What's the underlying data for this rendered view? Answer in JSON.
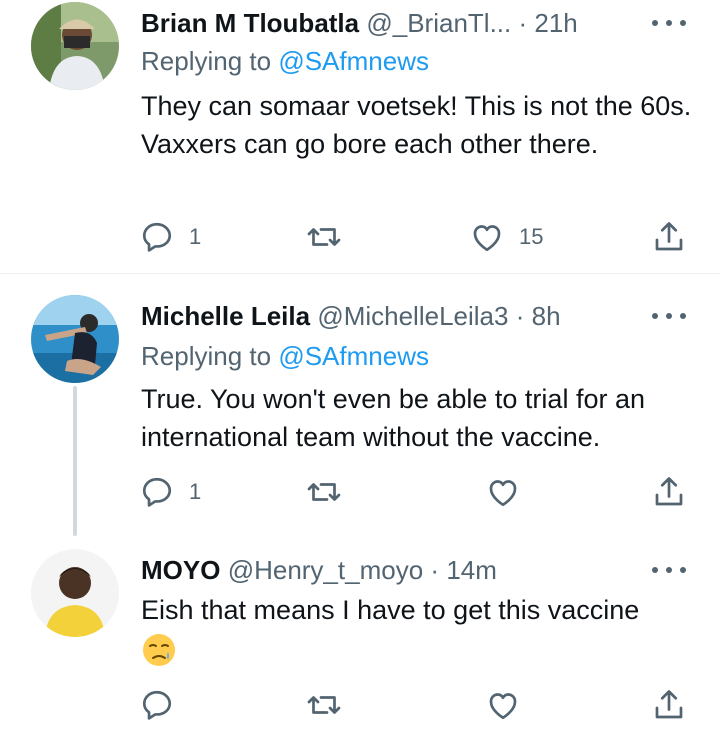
{
  "colors": {
    "text": "#0f1419",
    "secondary": "#536471",
    "link": "#1d9bf0",
    "thread_line": "#cfd9de"
  },
  "icons": {
    "reply": "speech-bubble-icon",
    "retweet": "retweet-arrows-icon",
    "like": "heart-icon",
    "share": "share-upload-icon",
    "more": "three-dots-icon"
  },
  "tweets": [
    {
      "name": "Brian M Tloubatla",
      "handle": "@_BrianTl...",
      "separator": "·",
      "time": "21h",
      "replying_label": "Replying to",
      "replying_to": "@SAfmnews",
      "text": "They can somaar voetsek! This is not the 60s. Vaxxers can go bore each other there.",
      "reply_count": "1",
      "retweet_count": "",
      "like_count": "15"
    },
    {
      "name": "Michelle Leila",
      "handle": "@MichelleLeila3",
      "separator": "·",
      "time": "8h",
      "replying_label": "Replying to",
      "replying_to": "@SAfmnews",
      "text": "True. You won't even be able to trial for an international team without the vaccine.",
      "reply_count": "1",
      "retweet_count": "",
      "like_count": ""
    },
    {
      "name": "MOYO",
      "handle": "@Henry_t_moyo",
      "separator": "·",
      "time": "14m",
      "text": "Eish that means I have to get this vaccine",
      "emoji": "sad-relieved-face",
      "reply_count": "",
      "retweet_count": "",
      "like_count": ""
    }
  ]
}
